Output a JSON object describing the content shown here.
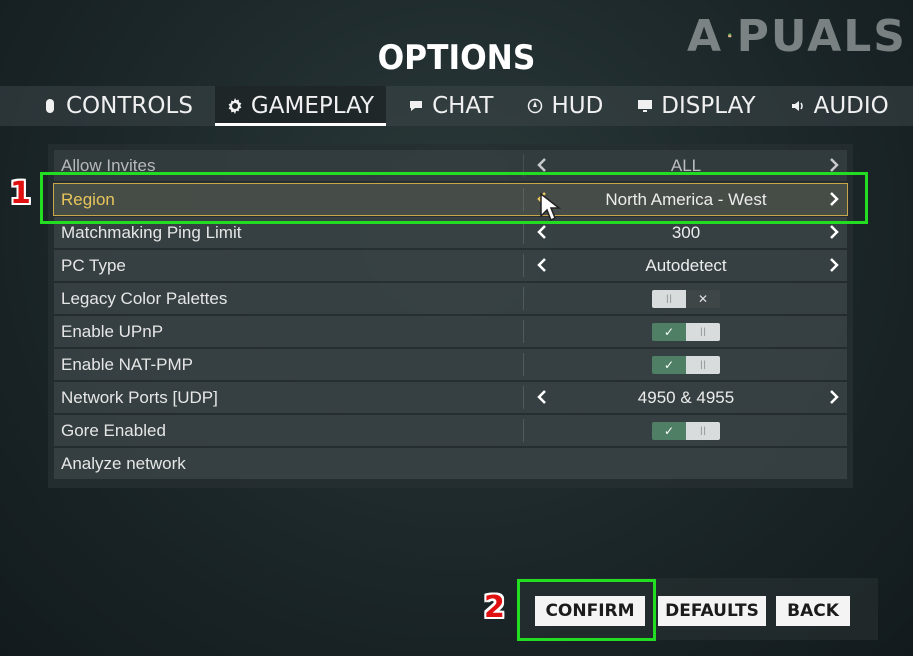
{
  "watermark": {
    "text": "APPUALS"
  },
  "page": {
    "title": "OPTIONS"
  },
  "tabs": [
    {
      "label": "CONTROLS",
      "icon": "mouse-icon",
      "active": false
    },
    {
      "label": "GAMEPLAY",
      "icon": "gear-icon",
      "active": true
    },
    {
      "label": "CHAT",
      "icon": "speech-bubble-icon",
      "active": false
    },
    {
      "label": "HUD",
      "icon": "compass-icon",
      "active": false
    },
    {
      "label": "DISPLAY",
      "icon": "monitor-icon",
      "active": false
    },
    {
      "label": "AUDIO",
      "icon": "speaker-icon",
      "active": false
    }
  ],
  "settings": [
    {
      "label": "Allow Invites",
      "type": "selector",
      "value": "ALL"
    },
    {
      "label": "Region",
      "type": "selector",
      "value": "North America - West"
    },
    {
      "label": "Matchmaking Ping Limit",
      "type": "selector",
      "value": "300"
    },
    {
      "label": "PC Type",
      "type": "selector",
      "value": "Autodetect"
    },
    {
      "label": "Legacy Color Palettes",
      "type": "toggle",
      "value": "off"
    },
    {
      "label": "Enable UPnP",
      "type": "toggle",
      "value": "on"
    },
    {
      "label": "Enable NAT-PMP",
      "type": "toggle",
      "value": "on"
    },
    {
      "label": "Network Ports [UDP]",
      "type": "selector",
      "value": "4950 & 4955"
    },
    {
      "label": "Gore Enabled",
      "type": "toggle",
      "value": "on"
    },
    {
      "label": "Analyze network",
      "type": "action",
      "value": ""
    }
  ],
  "annotations": {
    "step1": "1",
    "step2": "2"
  },
  "buttons": {
    "confirm": "CONFIRM",
    "defaults": "DEFAULTS",
    "back": "BACK"
  },
  "colors": {
    "highlight": "#e9c55b",
    "annotation_green": "#22dd22",
    "annotation_red": "#e01010",
    "toggle_on": "#4f7f64"
  }
}
